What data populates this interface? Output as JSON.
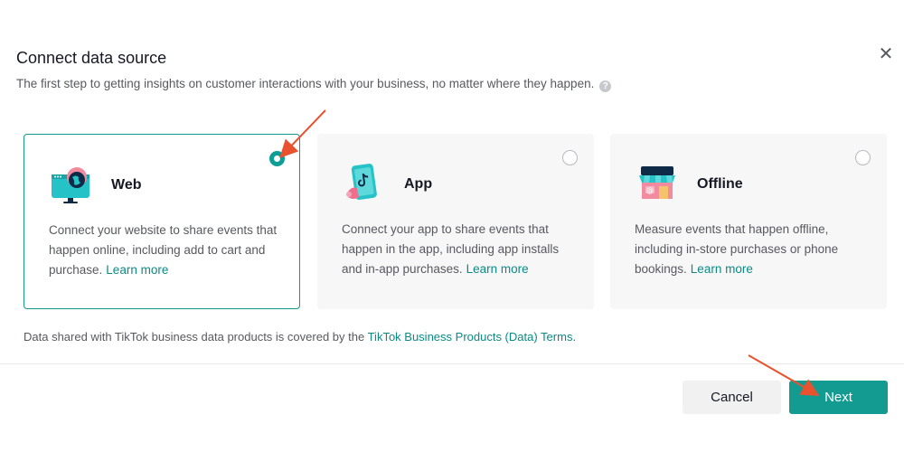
{
  "dialog": {
    "title": "Connect data source",
    "subtitle": "The first step to getting insights on customer interactions with your business, no matter where they happen.",
    "help_glyph": "?",
    "close_glyph": "✕"
  },
  "options": [
    {
      "title": "Web",
      "description": "Connect your website to share events that happen online, including add to cart and purchase.",
      "learn_more": "Learn more",
      "selected": true
    },
    {
      "title": "App",
      "description": "Connect your app to share events that happen in the app, including app installs and in-app purchases.",
      "learn_more": "Learn more",
      "selected": false
    },
    {
      "title": "Offline",
      "description": "Measure events that happen offline, including in-store purchases or phone bookings.",
      "learn_more": "Learn more",
      "selected": false
    }
  ],
  "terms": {
    "prefix": "Data shared with TikTok business data products is covered by the",
    "link": "TikTok Business Products (Data) Terms",
    "suffix": "."
  },
  "footer": {
    "cancel_label": "Cancel",
    "next_label": "Next"
  },
  "colors": {
    "accent": "#139b92",
    "link": "#0b8a84",
    "annotation_arrow": "#e8522e"
  },
  "icons": {
    "web": "monitor-globe-icon",
    "app": "phone-tiktok-icon",
    "offline": "storefront-icon"
  }
}
